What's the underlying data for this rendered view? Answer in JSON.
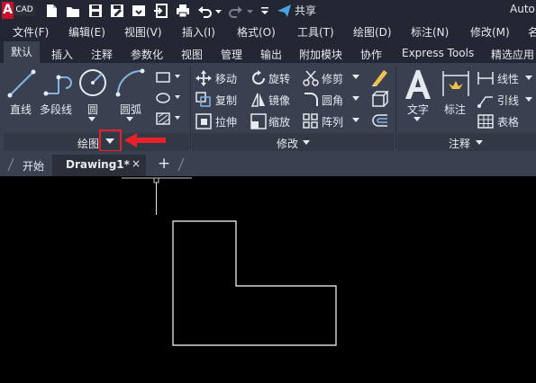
{
  "app": {
    "logo_letter": "A",
    "logo_text": "CAD",
    "title": "Auto",
    "share_label": "共享"
  },
  "quick_access": [
    "new-icon",
    "open-icon",
    "save-icon",
    "save-as-icon",
    "cloud-open-icon",
    "import-icon",
    "print-icon",
    "undo-icon",
    "redo-icon",
    "customize-dropdown-icon",
    "share-icon"
  ],
  "menu": [
    "文件(F)",
    "编辑(E)",
    "视图(V)",
    "插入(I)",
    "格式(O)",
    "工具(T)",
    "绘图(D)",
    "标注(N)",
    "修改(M)",
    "名"
  ],
  "ribbon_tabs": [
    "默认",
    "插入",
    "注释",
    "参数化",
    "视图",
    "管理",
    "输出",
    "附加模块",
    "协作",
    "Express Tools",
    "精选应用"
  ],
  "draw_panel": {
    "title": "绘图",
    "tools": [
      "直线",
      "多段线",
      "圆",
      "圆弧"
    ]
  },
  "modify_panel": {
    "title": "修改",
    "tools": [
      "移动",
      "旋转",
      "修剪",
      "复制",
      "镜像",
      "圆角",
      "拉伸",
      "缩放",
      "阵列"
    ]
  },
  "annotation_panel": {
    "title": "注释",
    "tools": [
      "文字",
      "标注",
      "线性",
      "引线",
      "表格"
    ]
  },
  "doc_tabs": {
    "start": "开始",
    "active": "Drawing1*",
    "close": "×",
    "add": "+"
  },
  "colors": {
    "accent": "#e8202a",
    "ribbon": "#3b4050",
    "titlebar": "#222733",
    "canvas": "#000000"
  }
}
